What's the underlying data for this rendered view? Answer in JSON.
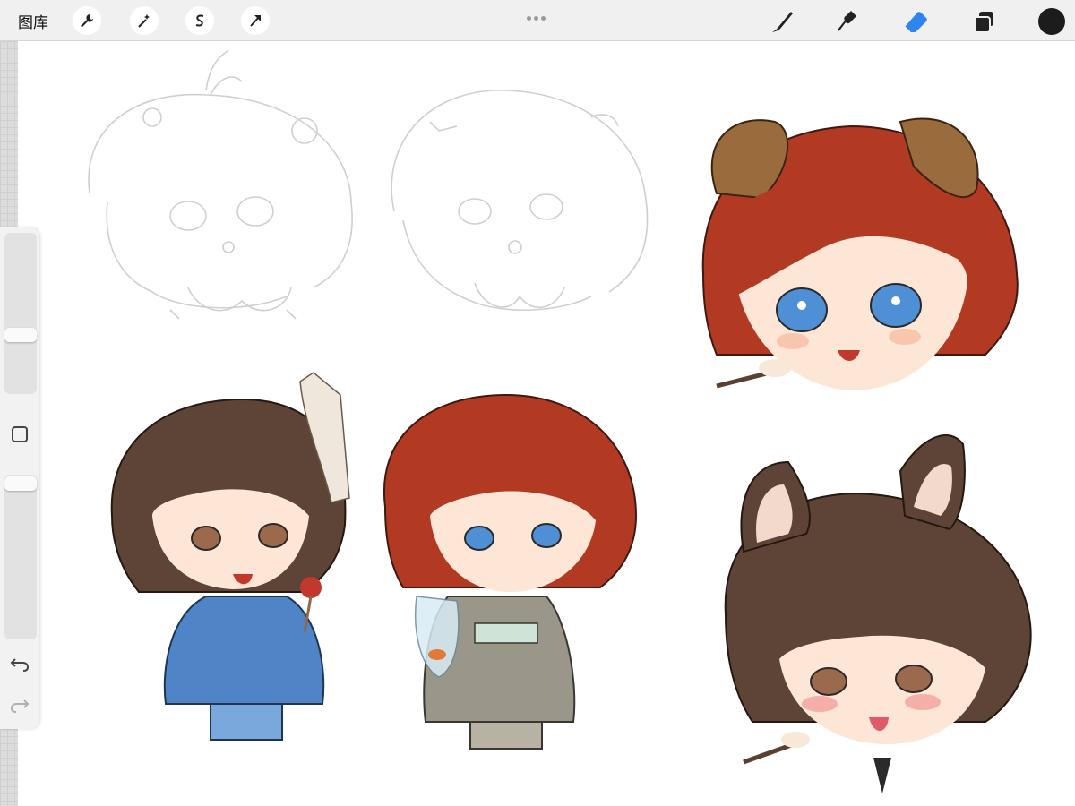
{
  "toolbar": {
    "gallery_label": "图库",
    "left_tools": [
      {
        "name": "actions",
        "icon": "wrench-icon"
      },
      {
        "name": "adjustments",
        "icon": "magic-wand-icon"
      },
      {
        "name": "selection",
        "icon": "selection-s-icon"
      },
      {
        "name": "transform",
        "icon": "arrow-cursor-icon"
      }
    ],
    "right_tools": [
      {
        "name": "brush",
        "icon": "brush-icon"
      },
      {
        "name": "smudge",
        "icon": "smudge-icon"
      },
      {
        "name": "eraser",
        "icon": "eraser-icon",
        "active": true,
        "color": "#2f84f0"
      },
      {
        "name": "layers",
        "icon": "layers-icon"
      },
      {
        "name": "color",
        "icon": "color-swatch-icon",
        "color": "#1c1c1c"
      }
    ]
  },
  "sidebar": {
    "brush_size_slider": {
      "icon": "slider-icon"
    },
    "modify_button": {
      "icon": "square-icon"
    },
    "opacity_slider": {
      "icon": "slider-icon"
    },
    "undo": {
      "icon": "undo-icon"
    },
    "redo": {
      "icon": "redo-icon"
    }
  },
  "canvas": {
    "description_items": [
      "chibi-sketch-left",
      "chibi-sketch-middle",
      "red-hair-dog-ears-head",
      "brown-hair-blue-kimono-chibi",
      "red-hair-grey-kimono-chibi",
      "brown-hair-cat-ears-head"
    ],
    "colors": {
      "red_hair": "#b23a22",
      "brown_hair": "#5e4436",
      "blue_kimono": "#4f85c6",
      "grey_kimono": "#9a968a",
      "blue_eyes": "#4f8fd6"
    }
  }
}
